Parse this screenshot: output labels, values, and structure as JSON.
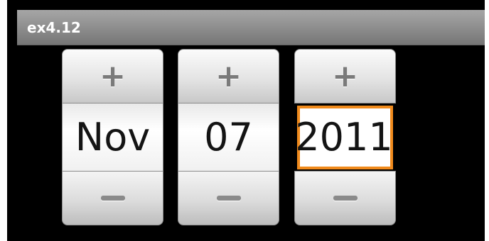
{
  "app": {
    "title": "ex4.12"
  },
  "date_picker": {
    "month": {
      "value": "Nov",
      "increment_label": "+",
      "decrement_label": "−"
    },
    "day": {
      "value": "07",
      "increment_label": "+",
      "decrement_label": "−"
    },
    "year": {
      "value": "2011",
      "increment_label": "+",
      "decrement_label": "−",
      "focused": true
    }
  },
  "colors": {
    "focus_border": "#f08a1c",
    "title_bar": "#8c8c8c",
    "background": "#000000"
  }
}
